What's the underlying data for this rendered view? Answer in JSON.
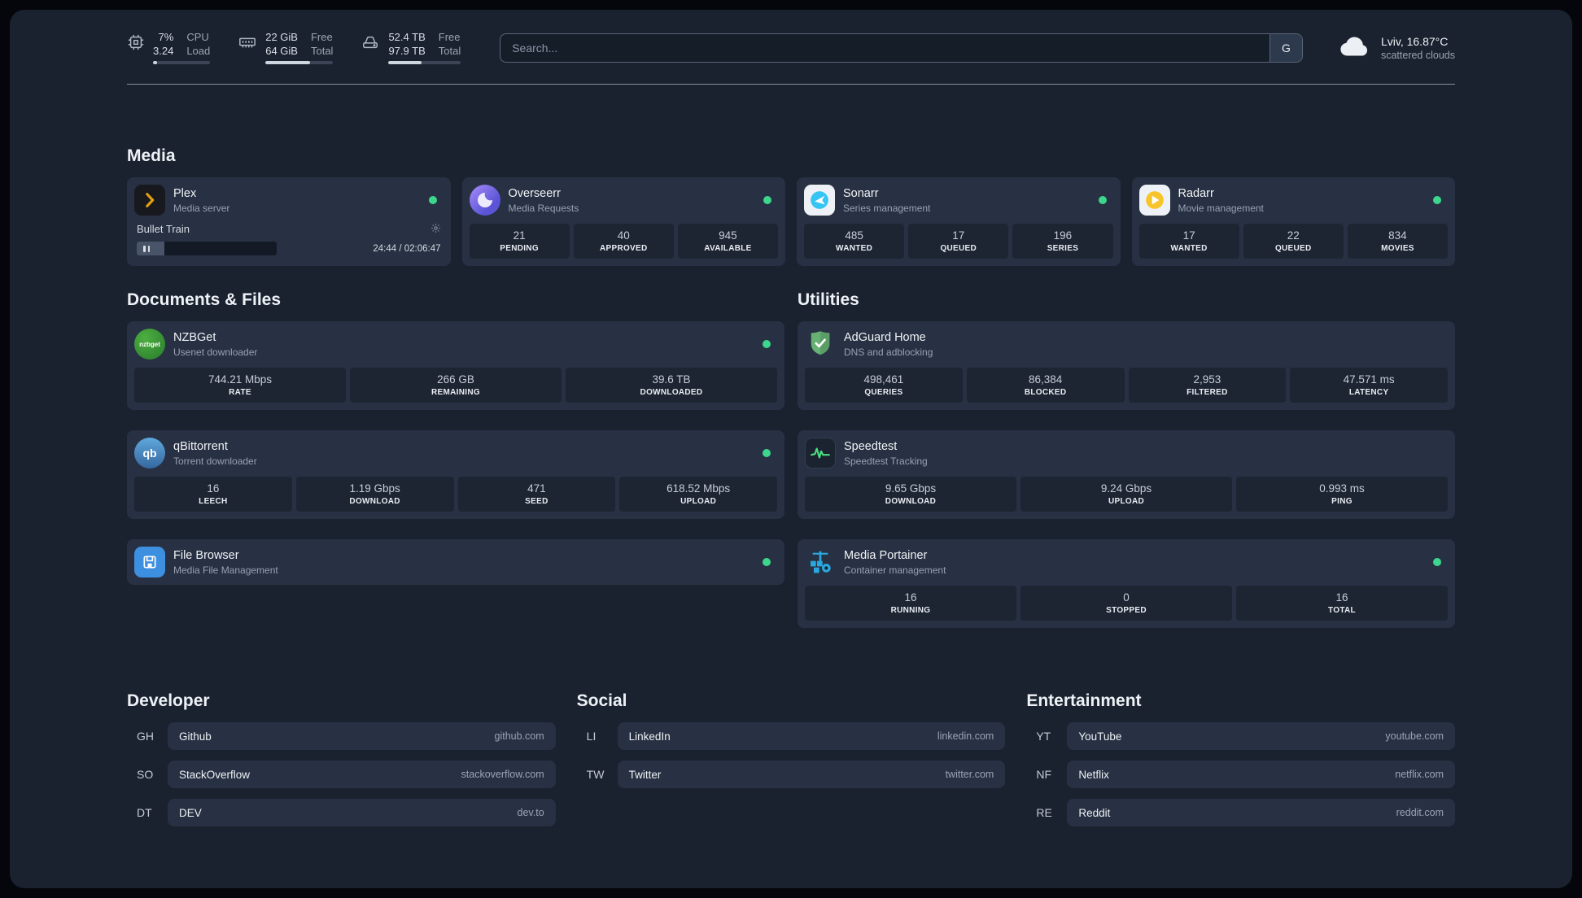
{
  "colors": {
    "status_online": "#3dd68c",
    "plex_brand": "#e5a00d",
    "overseerr_brand": "#6d5ce8",
    "sonarr_brand": "#35c5f4",
    "radarr_brand": "#f7c52b",
    "nzbget_brand": "#3a9e3e",
    "qbittorrent_brand": "#4a86c6",
    "filebrowser_brand": "#3d8fe0",
    "adguard_brand": "#67b173",
    "speedtest_accent": "#4ade80",
    "portainer_brand": "#29a8e0"
  },
  "header": {
    "cpu": {
      "value_top": "7%",
      "value_bottom": "3.24",
      "label_top": "CPU",
      "label_bottom": "Load",
      "percent": 7
    },
    "memory": {
      "value_top": "22 GiB",
      "value_bottom": "64 GiB",
      "label_top": "Free",
      "label_bottom": "Total",
      "percent": 66
    },
    "disk": {
      "value_top": "52.4 TB",
      "value_bottom": "97.9 TB",
      "label_top": "Free",
      "label_bottom": "Total",
      "percent": 46
    },
    "search": {
      "placeholder": "Search...",
      "button_label": "G"
    },
    "weather": {
      "location": "Lviv, 16.87°C",
      "condition": "scattered clouds"
    }
  },
  "icon_texts": {
    "nzbget": "nzbget",
    "qbittorrent": "qb"
  },
  "sections": {
    "media": {
      "title": "Media",
      "plex": {
        "title": "Plex",
        "subtitle": "Media server",
        "now_playing": "Bullet Train",
        "time": "24:44 / 02:06:47",
        "progress_percent": 20
      },
      "overseerr": {
        "title": "Overseerr",
        "subtitle": "Media Requests",
        "stats": [
          {
            "value": "21",
            "label": "PENDING"
          },
          {
            "value": "40",
            "label": "APPROVED"
          },
          {
            "value": "945",
            "label": "AVAILABLE"
          }
        ]
      },
      "sonarr": {
        "title": "Sonarr",
        "subtitle": "Series management",
        "stats": [
          {
            "value": "485",
            "label": "WANTED"
          },
          {
            "value": "17",
            "label": "QUEUED"
          },
          {
            "value": "196",
            "label": "SERIES"
          }
        ]
      },
      "radarr": {
        "title": "Radarr",
        "subtitle": "Movie management",
        "stats": [
          {
            "value": "17",
            "label": "WANTED"
          },
          {
            "value": "22",
            "label": "QUEUED"
          },
          {
            "value": "834",
            "label": "MOVIES"
          }
        ]
      }
    },
    "documents": {
      "title": "Documents & Files",
      "nzbget": {
        "title": "NZBGet",
        "subtitle": "Usenet downloader",
        "stats": [
          {
            "value": "744.21 Mbps",
            "label": "RATE"
          },
          {
            "value": "266 GB",
            "label": "REMAINING"
          },
          {
            "value": "39.6 TB",
            "label": "DOWNLOADED"
          }
        ]
      },
      "qbittorrent": {
        "title": "qBittorrent",
        "subtitle": "Torrent downloader",
        "stats": [
          {
            "value": "16",
            "label": "LEECH"
          },
          {
            "value": "1.19 Gbps",
            "label": "DOWNLOAD"
          },
          {
            "value": "471",
            "label": "SEED"
          },
          {
            "value": "618.52 Mbps",
            "label": "UPLOAD"
          }
        ]
      },
      "filebrowser": {
        "title": "File Browser",
        "subtitle": "Media File Management"
      }
    },
    "utilities": {
      "title": "Utilities",
      "adguard": {
        "title": "AdGuard Home",
        "subtitle": "DNS and adblocking",
        "stats": [
          {
            "value": "498,461",
            "label": "QUERIES"
          },
          {
            "value": "86,384",
            "label": "BLOCKED"
          },
          {
            "value": "2,953",
            "label": "FILTERED"
          },
          {
            "value": "47.571 ms",
            "label": "LATENCY"
          }
        ]
      },
      "speedtest": {
        "title": "Speedtest",
        "subtitle": "Speedtest Tracking",
        "stats": [
          {
            "value": "9.65 Gbps",
            "label": "DOWNLOAD"
          },
          {
            "value": "9.24 Gbps",
            "label": "UPLOAD"
          },
          {
            "value": "0.993 ms",
            "label": "PING"
          }
        ]
      },
      "portainer": {
        "title": "Media Portainer",
        "subtitle": "Container management",
        "stats": [
          {
            "value": "16",
            "label": "RUNNING"
          },
          {
            "value": "0",
            "label": "STOPPED"
          },
          {
            "value": "16",
            "label": "TOTAL"
          }
        ]
      }
    },
    "developer": {
      "title": "Developer",
      "links": [
        {
          "abbr": "GH",
          "name": "Github",
          "domain": "github.com"
        },
        {
          "abbr": "SO",
          "name": "StackOverflow",
          "domain": "stackoverflow.com"
        },
        {
          "abbr": "DT",
          "name": "DEV",
          "domain": "dev.to"
        }
      ]
    },
    "social": {
      "title": "Social",
      "links": [
        {
          "abbr": "LI",
          "name": "LinkedIn",
          "domain": "linkedin.com"
        },
        {
          "abbr": "TW",
          "name": "Twitter",
          "domain": "twitter.com"
        }
      ]
    },
    "entertainment": {
      "title": "Entertainment",
      "links": [
        {
          "abbr": "YT",
          "name": "YouTube",
          "domain": "youtube.com"
        },
        {
          "abbr": "NF",
          "name": "Netflix",
          "domain": "netflix.com"
        },
        {
          "abbr": "RE",
          "name": "Reddit",
          "domain": "reddit.com"
        }
      ]
    }
  }
}
